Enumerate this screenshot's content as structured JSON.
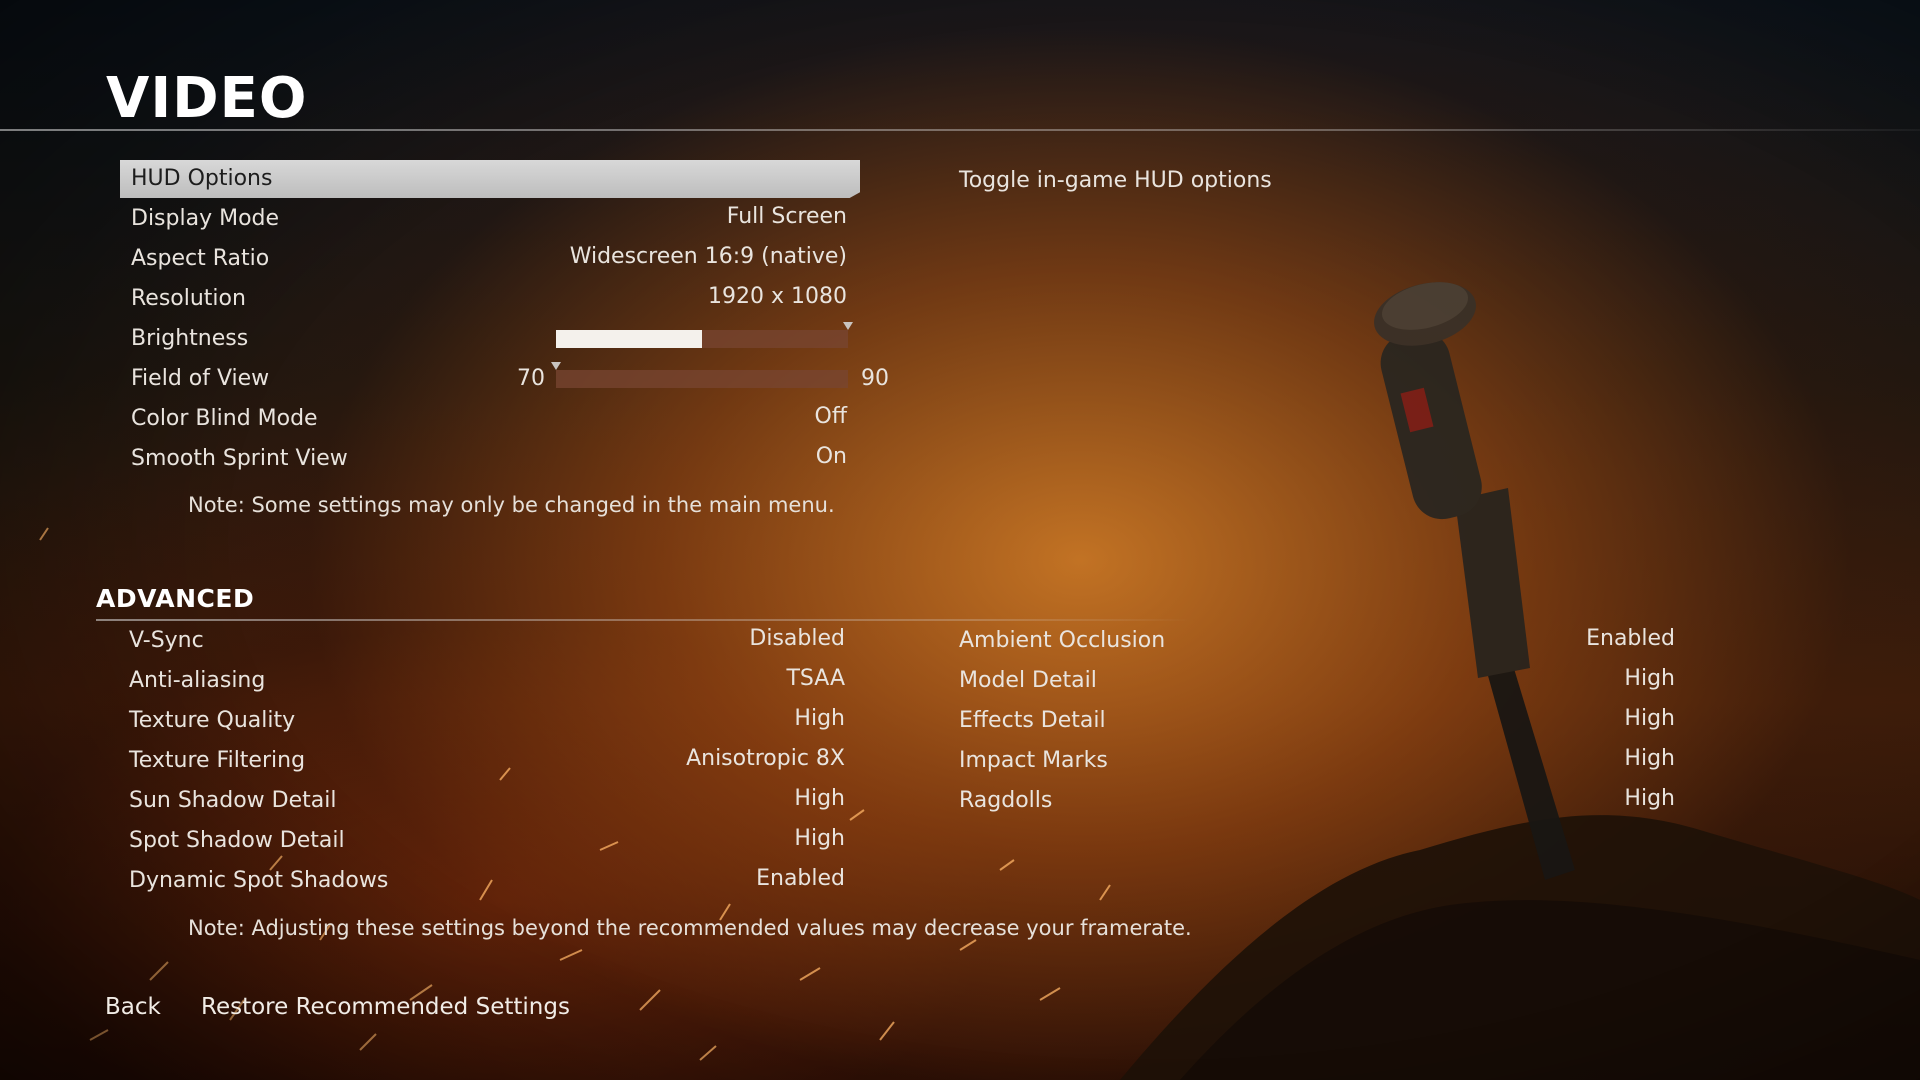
{
  "screen": {
    "title": "VIDEO",
    "help_text": "Toggle in-game HUD options"
  },
  "video_settings": [
    {
      "label": "HUD Options",
      "value": "",
      "selected": true
    },
    {
      "label": "Display Mode",
      "value": "Full Screen"
    },
    {
      "label": "Aspect Ratio",
      "value": "Widescreen 16:9 (native)"
    },
    {
      "label": "Resolution",
      "value": "1920 x 1080"
    },
    {
      "label": "Brightness",
      "value": "",
      "slider_fraction": 0.5
    },
    {
      "label": "Field of View",
      "value": "",
      "min": "70",
      "max": "90",
      "slider_fraction": 0.0
    },
    {
      "label": "Color Blind Mode",
      "value": "Off"
    },
    {
      "label": "Smooth Sprint View",
      "value": "On"
    }
  ],
  "video_note": "Note: Some settings may only be changed in the main menu.",
  "advanced": {
    "title": "ADVANCED",
    "left": [
      {
        "label": "V-Sync",
        "value": "Disabled"
      },
      {
        "label": "Anti-aliasing",
        "value": "TSAA"
      },
      {
        "label": "Texture Quality",
        "value": "High"
      },
      {
        "label": "Texture Filtering",
        "value": "Anisotropic 8X"
      },
      {
        "label": "Sun Shadow Detail",
        "value": "High"
      },
      {
        "label": "Spot Shadow Detail",
        "value": "High"
      },
      {
        "label": "Dynamic Spot Shadows",
        "value": "Enabled"
      }
    ],
    "right": [
      {
        "label": "Ambient Occlusion",
        "value": "Enabled"
      },
      {
        "label": "Model Detail",
        "value": "High"
      },
      {
        "label": "Effects Detail",
        "value": "High"
      },
      {
        "label": "Impact Marks",
        "value": "High"
      },
      {
        "label": "Ragdolls",
        "value": "High"
      }
    ],
    "note": "Note: Adjusting these settings beyond the recommended values may decrease your framerate."
  },
  "footer": {
    "back_label": "Back",
    "restore_label": "Restore Recommended Settings"
  },
  "colors": {
    "selected_row": "#c8c8c8",
    "slider_fill": "#f4f1ec",
    "slider_track": "#784632"
  }
}
